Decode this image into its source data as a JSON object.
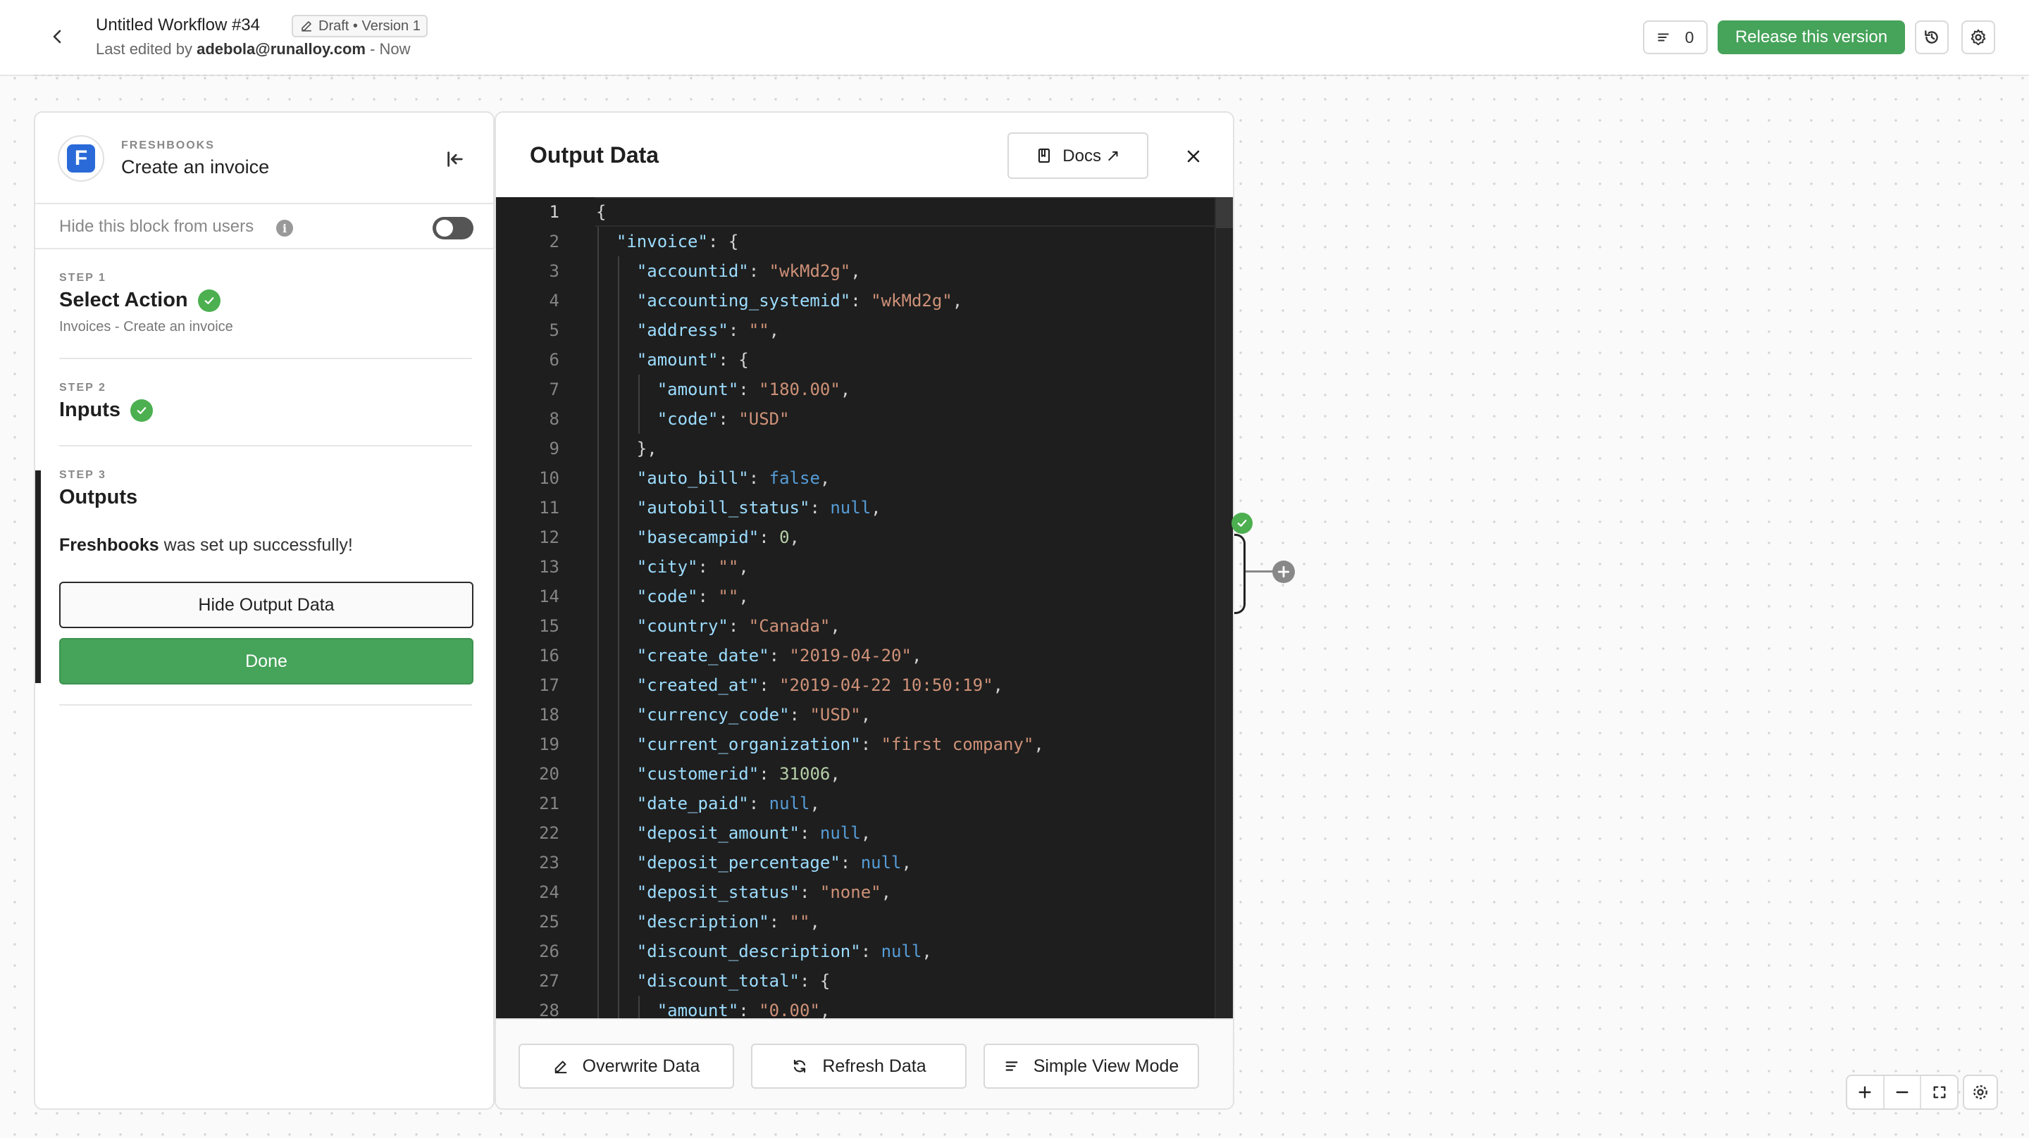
{
  "header": {
    "workflow_title": "Untitled Workflow #34",
    "status_badge": "Draft • Version 1",
    "last_edited_prefix": "Last edited by",
    "last_edited_user": "adebola@runalloy.com",
    "last_edited_suffix": "- Now",
    "counter_value": "0",
    "release_label": "Release this version"
  },
  "block": {
    "provider": "FRESHBOOKS",
    "title": "Create an invoice",
    "logo_letter": "F",
    "hide_label": "Hide this block from users",
    "hide_enabled": false
  },
  "steps": [
    {
      "num": "STEP 1",
      "title": "Select Action",
      "subtitle": "Invoices - Create an invoice",
      "complete": true
    },
    {
      "num": "STEP 2",
      "title": "Inputs",
      "complete": true
    },
    {
      "num": "STEP 3",
      "title": "Outputs",
      "complete": false
    }
  ],
  "outputs": {
    "success_app": "Freshbooks",
    "success_text": "was set up successfully!",
    "hide_output_label": "Hide Output Data",
    "done_label": "Done"
  },
  "output_panel": {
    "title": "Output Data",
    "docs_label": "Docs ↗",
    "footer_buttons": [
      "Overwrite Data",
      "Refresh Data",
      "Simple View Mode"
    ]
  },
  "code_lines": [
    {
      "n": 1,
      "indent": 0,
      "key": "",
      "value": "{",
      "type": "p"
    },
    {
      "n": 2,
      "indent": 1,
      "key": "\"invoice\"",
      "value": "{",
      "type": "p"
    },
    {
      "n": 3,
      "indent": 2,
      "key": "\"accountid\"",
      "value": "\"wkMd2g\"",
      "type": "s",
      "comma": true
    },
    {
      "n": 4,
      "indent": 2,
      "key": "\"accounting_systemid\"",
      "value": "\"wkMd2g\"",
      "type": "s",
      "comma": true
    },
    {
      "n": 5,
      "indent": 2,
      "key": "\"address\"",
      "value": "\"\"",
      "type": "s",
      "comma": true
    },
    {
      "n": 6,
      "indent": 2,
      "key": "\"amount\"",
      "value": "{",
      "type": "p"
    },
    {
      "n": 7,
      "indent": 3,
      "key": "\"amount\"",
      "value": "\"180.00\"",
      "type": "s",
      "comma": true
    },
    {
      "n": 8,
      "indent": 3,
      "key": "\"code\"",
      "value": "\"USD\"",
      "type": "s"
    },
    {
      "n": 9,
      "indent": 2,
      "key": "",
      "value": "},",
      "type": "p"
    },
    {
      "n": 10,
      "indent": 2,
      "key": "\"auto_bill\"",
      "value": "false",
      "type": "kw",
      "comma": true
    },
    {
      "n": 11,
      "indent": 2,
      "key": "\"autobill_status\"",
      "value": "null",
      "type": "kw",
      "comma": true
    },
    {
      "n": 12,
      "indent": 2,
      "key": "\"basecampid\"",
      "value": "0",
      "type": "n",
      "comma": true
    },
    {
      "n": 13,
      "indent": 2,
      "key": "\"city\"",
      "value": "\"\"",
      "type": "s",
      "comma": true
    },
    {
      "n": 14,
      "indent": 2,
      "key": "\"code\"",
      "value": "\"\"",
      "type": "s",
      "comma": true
    },
    {
      "n": 15,
      "indent": 2,
      "key": "\"country\"",
      "value": "\"Canada\"",
      "type": "s",
      "comma": true
    },
    {
      "n": 16,
      "indent": 2,
      "key": "\"create_date\"",
      "value": "\"2019-04-20\"",
      "type": "s",
      "comma": true
    },
    {
      "n": 17,
      "indent": 2,
      "key": "\"created_at\"",
      "value": "\"2019-04-22 10:50:19\"",
      "type": "s",
      "comma": true
    },
    {
      "n": 18,
      "indent": 2,
      "key": "\"currency_code\"",
      "value": "\"USD\"",
      "type": "s",
      "comma": true
    },
    {
      "n": 19,
      "indent": 2,
      "key": "\"current_organization\"",
      "value": "\"first company\"",
      "type": "s",
      "comma": true
    },
    {
      "n": 20,
      "indent": 2,
      "key": "\"customerid\"",
      "value": "31006",
      "type": "n",
      "comma": true
    },
    {
      "n": 21,
      "indent": 2,
      "key": "\"date_paid\"",
      "value": "null",
      "type": "kw",
      "comma": true
    },
    {
      "n": 22,
      "indent": 2,
      "key": "\"deposit_amount\"",
      "value": "null",
      "type": "kw",
      "comma": true
    },
    {
      "n": 23,
      "indent": 2,
      "key": "\"deposit_percentage\"",
      "value": "null",
      "type": "kw",
      "comma": true
    },
    {
      "n": 24,
      "indent": 2,
      "key": "\"deposit_status\"",
      "value": "\"none\"",
      "type": "s",
      "comma": true
    },
    {
      "n": 25,
      "indent": 2,
      "key": "\"description\"",
      "value": "\"\"",
      "type": "s",
      "comma": true
    },
    {
      "n": 26,
      "indent": 2,
      "key": "\"discount_description\"",
      "value": "null",
      "type": "kw",
      "comma": true
    },
    {
      "n": 27,
      "indent": 2,
      "key": "\"discount_total\"",
      "value": "{",
      "type": "p"
    },
    {
      "n": 28,
      "indent": 3,
      "key": "\"amount\"",
      "value": "\"0.00\"",
      "type": "s",
      "comma": true
    }
  ],
  "colors": {
    "accent_green": "#46a35a",
    "check_green": "#4caf50",
    "editor_bg": "#1e1e1e",
    "json_key": "#9cdcfe",
    "json_string": "#ce9178",
    "json_number": "#b5cea8",
    "json_keyword": "#569cd6"
  },
  "icons": {
    "back": "chevron-left-icon",
    "badge": "pencil-icon",
    "counter": "list-icon",
    "history": "history-icon",
    "settings": "gear-icon",
    "collapse": "collapse-left-icon",
    "info": "info-icon",
    "check": "check-circle-icon",
    "docs": "book-icon",
    "close": "close-icon",
    "overwrite": "pencil-icon",
    "refresh": "refresh-icon",
    "simple_view": "list-icon",
    "zoom_in": "plus-icon",
    "zoom_out": "minus-icon",
    "fit": "fullscreen-icon"
  }
}
